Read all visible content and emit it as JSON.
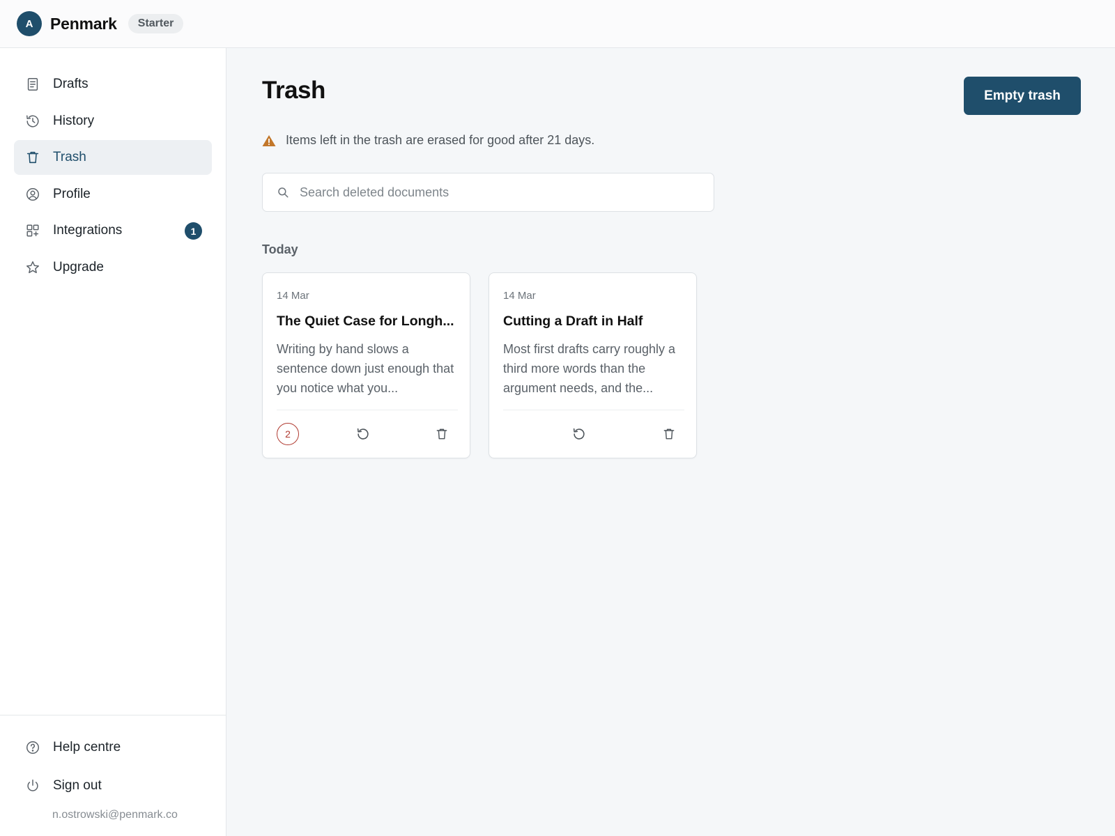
{
  "app": {
    "logo_letter": "A",
    "name": "Penmark",
    "plan": "Starter"
  },
  "sidebar": {
    "items": [
      {
        "label": "Drafts",
        "icon": "document-icon"
      },
      {
        "label": "History",
        "icon": "history-icon"
      },
      {
        "label": "Trash",
        "icon": "trash-icon",
        "active": true
      },
      {
        "label": "Profile",
        "icon": "user-circle-icon"
      },
      {
        "label": "Integrations",
        "icon": "apps-grid-icon",
        "badge": "1"
      },
      {
        "label": "Upgrade",
        "icon": "star-icon"
      }
    ],
    "footer": [
      {
        "label": "Help centre",
        "icon": "help-circle-icon"
      },
      {
        "label": "Sign out",
        "icon": "power-icon"
      }
    ],
    "user_email": "n.ostrowski@penmark.co"
  },
  "main": {
    "title": "Trash",
    "empty_button": "Empty trash",
    "notice": "Items left in the trash are erased for good after 21 days.",
    "search": {
      "placeholder": "Search deleted documents",
      "value": ""
    },
    "section_label": "Today",
    "cards": [
      {
        "date": "14 Mar",
        "title": "The Quiet Case for Longh...",
        "excerpt": "Writing by hand slows a sentence down just enough that you notice what you...",
        "count": "2"
      },
      {
        "date": "14 Mar",
        "title": "Cutting a Draft in Half",
        "excerpt": "Most first drafts carry roughly a third more words than the argument needs, and the..."
      }
    ]
  },
  "colors": {
    "accent": "#1f4e6b",
    "warning": "#c2772a",
    "danger": "#b03a30",
    "background": "#f5f7f9"
  }
}
